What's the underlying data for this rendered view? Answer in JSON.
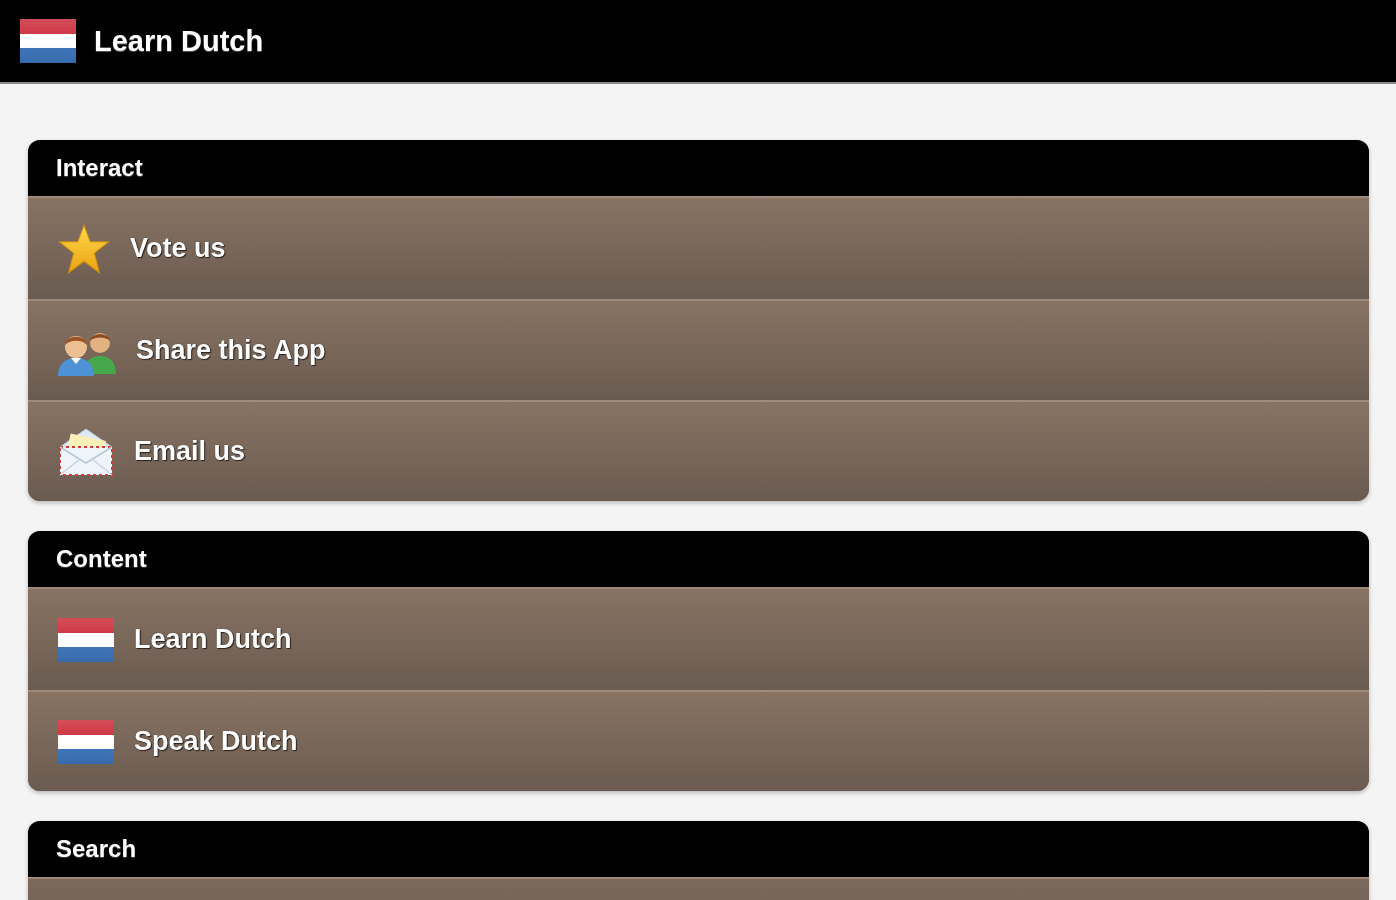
{
  "app_bar": {
    "title": "Learn Dutch"
  },
  "sections": [
    {
      "title": "Interact",
      "items": [
        {
          "label": "Vote us",
          "kind": "vote"
        },
        {
          "label": "Share this App",
          "kind": "share"
        },
        {
          "label": "Email us",
          "kind": "email"
        }
      ]
    },
    {
      "title": "Content",
      "items": [
        {
          "label": "Learn Dutch",
          "kind": "course"
        },
        {
          "label": "Speak Dutch",
          "kind": "course"
        }
      ]
    },
    {
      "title": "Search"
    }
  ]
}
